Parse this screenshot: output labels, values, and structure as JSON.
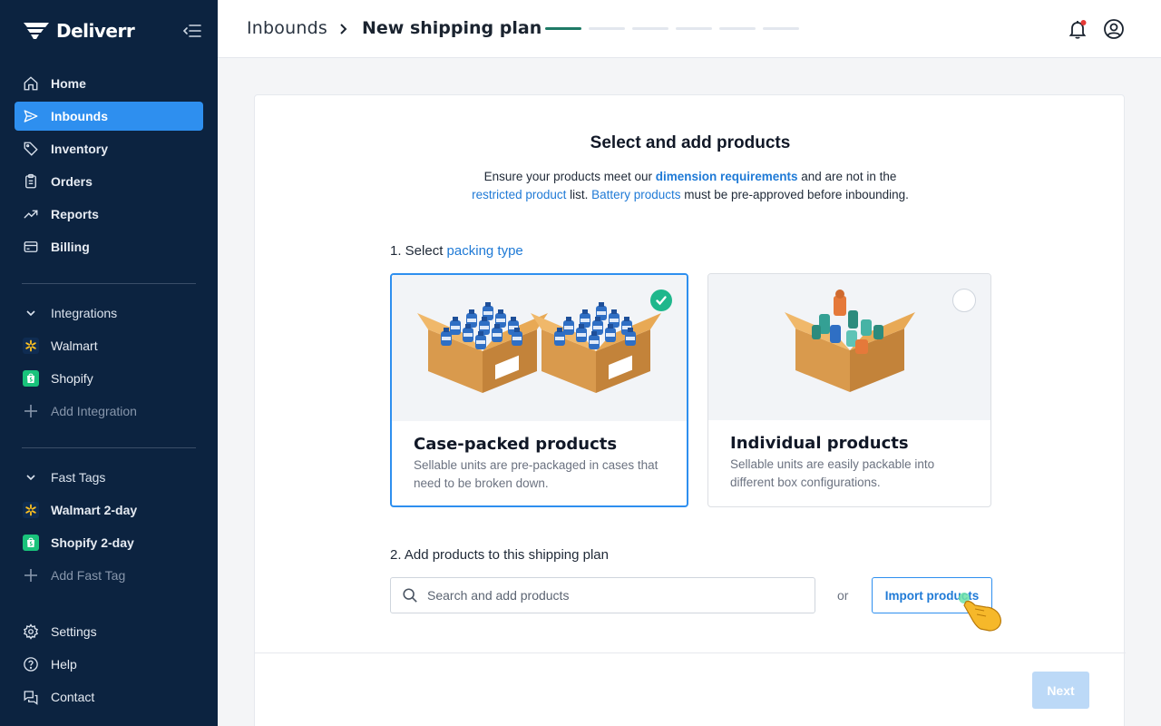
{
  "app": {
    "name": "Deliverr"
  },
  "sidebar": {
    "main_items": [
      {
        "label": "Home",
        "icon": "home-icon"
      },
      {
        "label": "Inbounds",
        "icon": "send-icon"
      },
      {
        "label": "Inventory",
        "icon": "tag-icon"
      },
      {
        "label": "Orders",
        "icon": "clipboard-icon"
      },
      {
        "label": "Reports",
        "icon": "trend-icon"
      },
      {
        "label": "Billing",
        "icon": "credit-card-icon"
      }
    ],
    "active_item": "Inbounds",
    "integrations": {
      "title": "Integrations",
      "items": [
        "Walmart",
        "Shopify"
      ],
      "add_label": "Add Integration"
    },
    "fast_tags": {
      "title": "Fast Tags",
      "items": [
        "Walmart 2-day",
        "Shopify 2-day"
      ],
      "add_label": "Add Fast Tag"
    },
    "bottom_items": [
      "Settings",
      "Help",
      "Contact"
    ]
  },
  "header": {
    "breadcrumb_parent": "Inbounds",
    "breadcrumb_current": "New shipping plan",
    "progress": {
      "total_steps": 6,
      "completed_steps": 1
    }
  },
  "card": {
    "title": "Select and add products",
    "desc": {
      "t1": "Ensure your products meet our ",
      "link1": "dimension requirements",
      "t2": " and are not in the",
      "link2": "restricted product",
      "t3": " list. ",
      "link3": "Battery products",
      "t4": " must be pre-approved before inbounding."
    },
    "step1": {
      "prefix": "1. Select ",
      "link": "packing type"
    },
    "options": [
      {
        "title": "Case-packed products",
        "desc": "Sellable units are pre-packaged in cases that need to be broken down.",
        "selected": true
      },
      {
        "title": "Individual products",
        "desc": "Sellable units are easily packable into different box configurations.",
        "selected": false
      }
    ],
    "step2": {
      "label": "2. Add products to this shipping plan"
    },
    "search": {
      "placeholder": "Search and add products",
      "value": ""
    },
    "or_text": "or",
    "import_label": "Import products",
    "next_label": "Next"
  },
  "colors": {
    "sidebar_bg": "#0c2340",
    "accent": "#2e8fef",
    "success": "#1fb78c",
    "progress_done": "#1e7a66"
  }
}
